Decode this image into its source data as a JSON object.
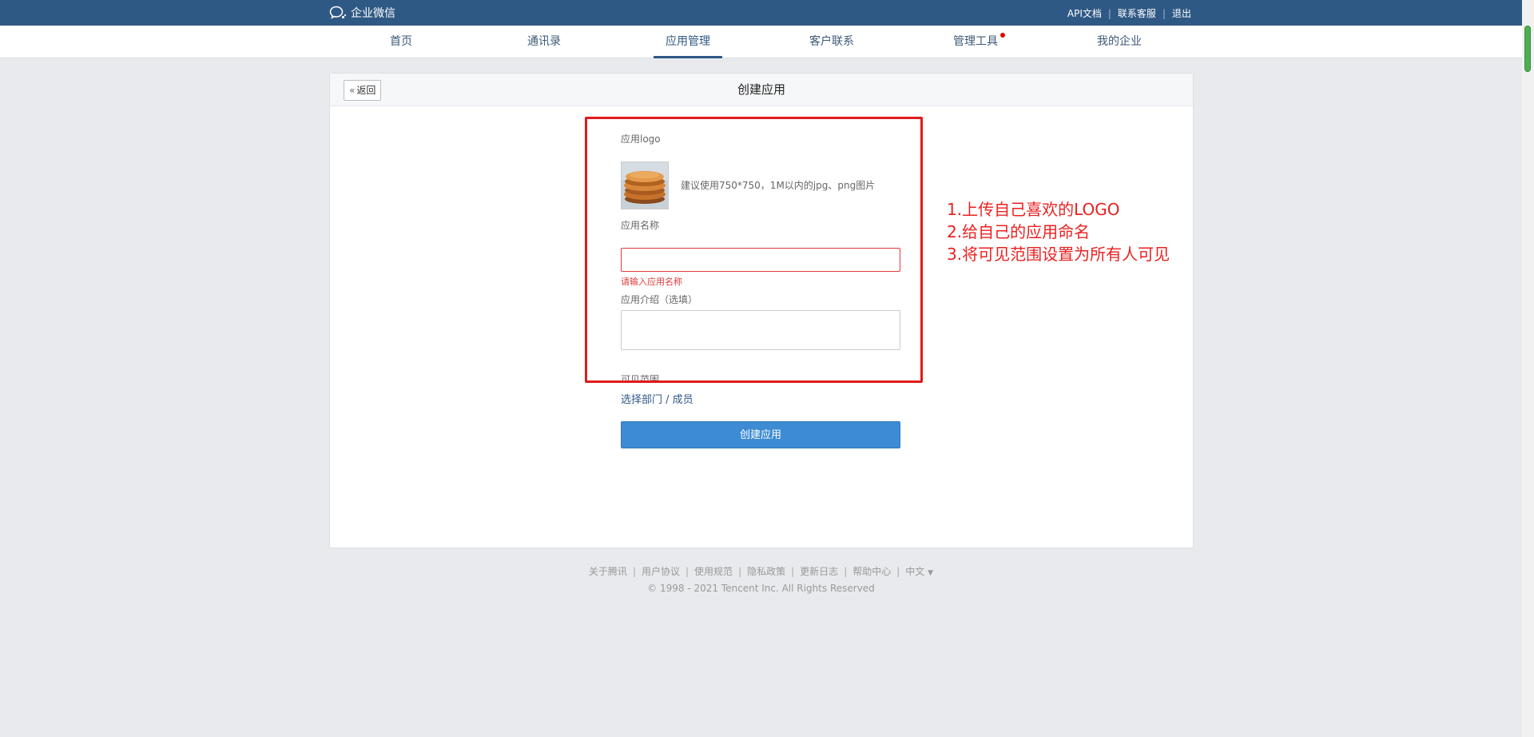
{
  "brand": {
    "name": "企业微信",
    "icon": "wecom-chat-icon"
  },
  "top_links": [
    "API文档",
    "联系客服",
    "退出"
  ],
  "nav": {
    "items": [
      {
        "label": "首页"
      },
      {
        "label": "通讯录"
      },
      {
        "label": "应用管理"
      },
      {
        "label": "客户联系"
      },
      {
        "label": "管理工具"
      },
      {
        "label": "我的企业"
      }
    ],
    "active": "应用管理",
    "notification_on": "管理工具"
  },
  "card": {
    "back_label": "返回",
    "title": "创建应用"
  },
  "form": {
    "logo_label": "应用logo",
    "logo_hint": "建议使用750*750，1M以内的jpg、png图片",
    "name_label": "应用名称",
    "name_value": "",
    "name_error": "请输入应用名称",
    "desc_label": "应用介绍（选填）",
    "visibility_label": "可见范围",
    "select_link": "选择部门 / 成员",
    "submit_label": "创建应用"
  },
  "annotation": {
    "lines": [
      "1.上传自己喜欢的LOGO",
      "2.给自己的应用命名",
      "3.将可见范围设置为所有人可见"
    ],
    "color": "#ea2121"
  },
  "footer": {
    "links": [
      "关于腾讯",
      "用户协议",
      "使用规范",
      "隐私政策",
      "更新日志",
      "帮助中心",
      "中文"
    ],
    "copyright": "© 1998 - 2021 Tencent Inc. All Rights Reserved"
  },
  "colors": {
    "topbar": "#2f5985",
    "primary_button": "#3d8bd3",
    "error": "#e23a3a",
    "page_bg": "#e8eaed"
  }
}
